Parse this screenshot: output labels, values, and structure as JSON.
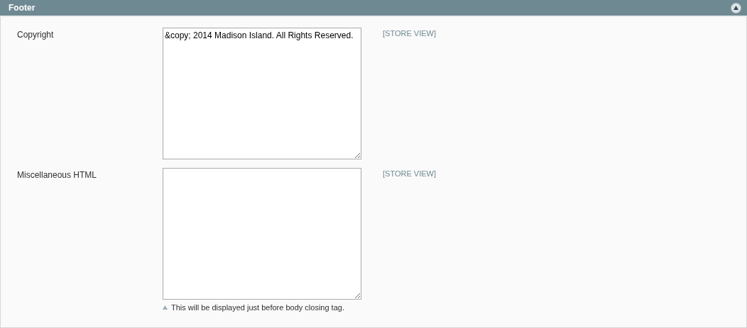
{
  "section": {
    "title": "Footer",
    "expanded": true
  },
  "fields": [
    {
      "label": "Copyright",
      "value": "&copy; 2014 Madison Island. All Rights Reserved.",
      "scope": "[STORE VIEW]"
    },
    {
      "label": "Miscellaneous HTML",
      "scope": "[STORE VIEW]",
      "note": "This will be displayed just before body closing tag."
    }
  ]
}
